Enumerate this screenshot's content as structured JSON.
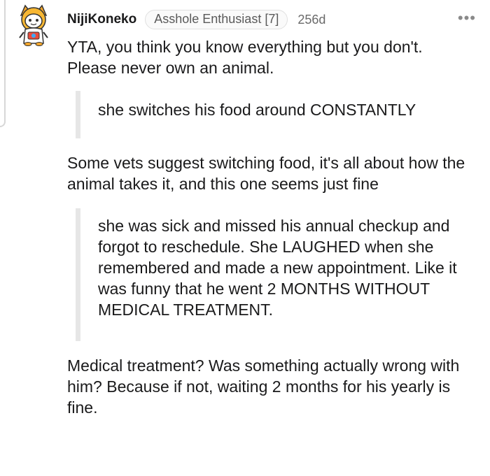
{
  "comment": {
    "username": "NijiKoneko",
    "flair": "Asshole Enthusiast [7]",
    "age": "256d",
    "more_label": "•••",
    "avatar_icon": "cat-snoo-avatar-icon",
    "paragraphs": [
      "YTA, you think you know everything but you don't. Please never own an animal.",
      "Some vets suggest switching food, it's all about how the animal takes it, and this one seems just fine",
      "Medical treatment? Was something actually wrong with him? Because if not, waiting 2 months for his yearly is fine."
    ],
    "quotes": [
      "she switches his food around CONSTANTLY",
      "she was sick and missed his annual checkup and forgot to reschedule. She LAUGHED when she remembered and made a new appointment. Like it was funny that he went 2 MONTHS WITHOUT MEDICAL TREATMENT."
    ]
  },
  "colors": {
    "text": "#1a1a1b",
    "meta": "#6a6a6a",
    "quote_bar": "#e6e6e6",
    "avatar_accent": "#f4a62a"
  }
}
